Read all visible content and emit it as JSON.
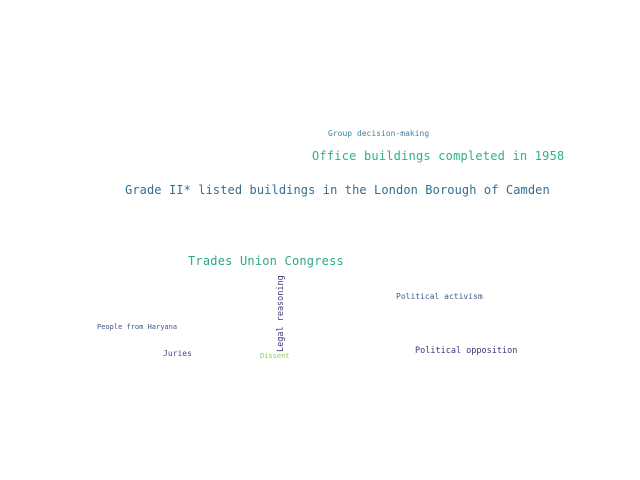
{
  "words": {
    "group_decision_making": {
      "text": "Group decision-making",
      "color": "#3f7fa0"
    },
    "office_buildings": {
      "text": "Office buildings completed in 1958",
      "color": "#2fb37d"
    },
    "grade_ii_listed": {
      "text": "Grade II* listed buildings in the London Borough of Camden",
      "color": "#336f91"
    },
    "trades_union_congress": {
      "text": "Trades Union Congress",
      "color": "#2fa889"
    },
    "legal_reasoning": {
      "text": "Legal reasoning",
      "color": "#45387d"
    },
    "political_activism": {
      "text": "Political activism",
      "color": "#3a5e8c"
    },
    "people_from_haryana": {
      "text": "People from Haryana",
      "color": "#3b5588"
    },
    "juries": {
      "text": "Juries",
      "color": "#3c4f8a"
    },
    "dissent": {
      "text": "Dissent",
      "color": "#8ccc4a"
    },
    "political_opposition": {
      "text": "Political opposition",
      "color": "#46317e"
    }
  }
}
